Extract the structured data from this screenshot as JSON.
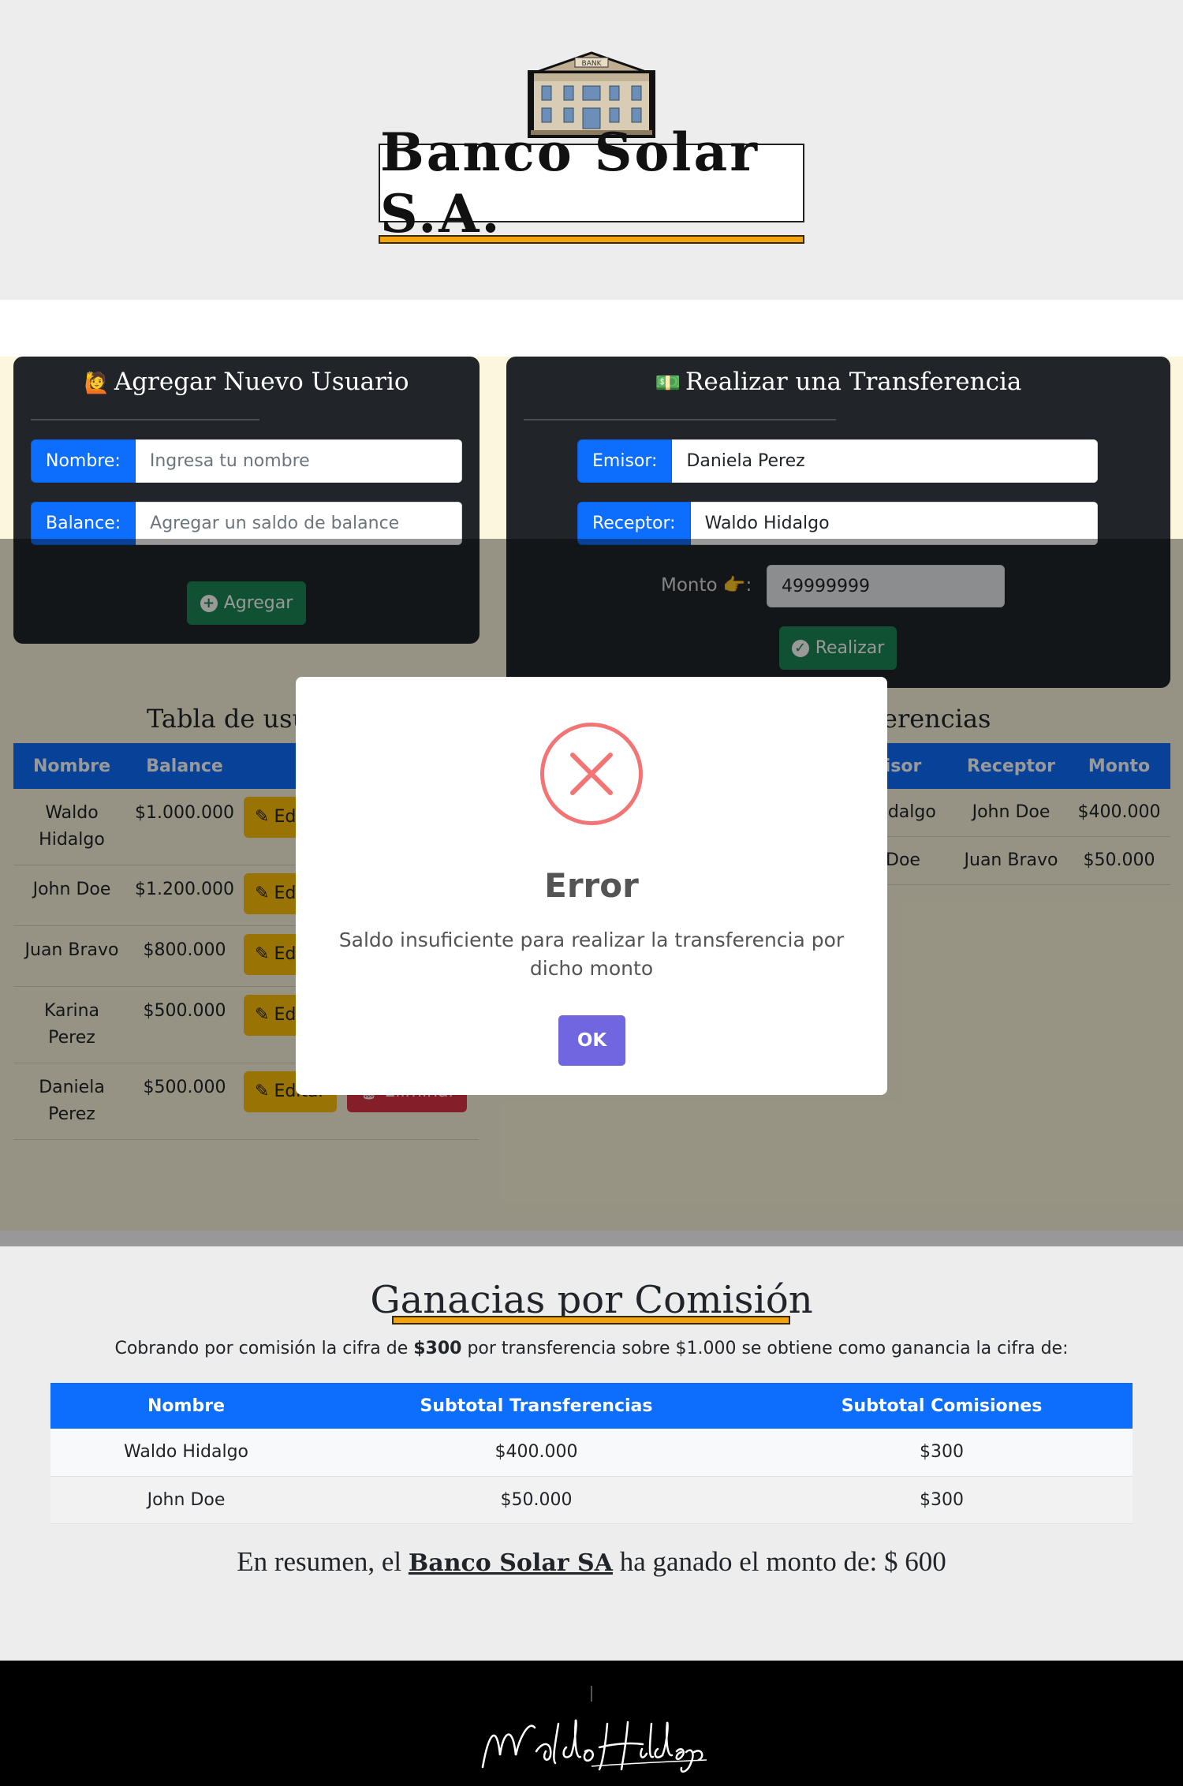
{
  "header": {
    "bank_sign": "BANK",
    "brand_title": "Banco Solar S.A."
  },
  "user_card": {
    "emoji": "🙋",
    "title": "Agregar Nuevo Usuario",
    "name_label": "Nombre:",
    "name_placeholder": "Ingresa tu nombre",
    "balance_label": "Balance:",
    "balance_placeholder": "Agregar un saldo de balance",
    "add_button": "Agregar",
    "add_icon": "plus-circle-icon"
  },
  "transfer_card": {
    "emoji": "💵",
    "title": "Realizar una Transferencia",
    "emisor_label": "Emisor:",
    "emisor_value": "Daniela Perez",
    "receptor_label": "Receptor:",
    "receptor_value": "Waldo Hidalgo",
    "monto_label": "Monto 👉:",
    "monto_value": "49999999",
    "submit_button": "Realizar",
    "submit_icon": "check-circle-icon"
  },
  "users_table": {
    "title": "Tabla de usua",
    "headers": [
      "Nombre",
      "Balance"
    ],
    "edit_label": "Editar",
    "delete_label": "Eliminar",
    "rows": [
      {
        "name": "Waldo Hidalgo",
        "balance": "$1.000.000"
      },
      {
        "name": "John Doe",
        "balance": "$1.200.000"
      },
      {
        "name": "Juan Bravo",
        "balance": "$800.000"
      },
      {
        "name": "Karina Perez",
        "balance": "$500.000"
      },
      {
        "name": "Daniela Perez",
        "balance": "$500.000"
      }
    ]
  },
  "transfers_table": {
    "title": "erencias",
    "headers": [
      "isor",
      "Receptor",
      "Monto"
    ],
    "rows": [
      {
        "emisor": "Hidalgo",
        "receptor": "John Doe",
        "monto": "$400.000"
      },
      {
        "emisor": "Doe",
        "receptor": "Juan Bravo",
        "monto": "$50.000"
      }
    ]
  },
  "modal": {
    "icon": "error-x-icon",
    "title": "Error",
    "text": "Saldo insuficiente para realizar la transferencia por dicho monto",
    "ok_button": "OK"
  },
  "ganancias": {
    "title": "Ganacias por Comisión",
    "desc_before": "Cobrando por comisión la cifra de",
    "desc_bold": "$300",
    "desc_after": "por transferencia sobre $1.000 se obtiene como ganancia la cifra de:",
    "headers": [
      "Nombre",
      "Subtotal Transferencias",
      "Subtotal Comisiones"
    ],
    "rows": [
      {
        "name": "Waldo Hidalgo",
        "subtotal": "$400.000",
        "comision": "$300"
      },
      {
        "name": "John Doe",
        "subtotal": "$50.000",
        "comision": "$300"
      }
    ],
    "summary_before": "En resumen, el",
    "summary_brand": "Banco Solar SA",
    "summary_after": "ha ganado el monto de: $ 600"
  },
  "footer": {
    "signature": "Waldo Hidalgo"
  },
  "colors": {
    "primary": "#0d6efd",
    "success": "#198754",
    "warning": "#ffc107",
    "danger": "#dc3545",
    "accent_gold": "#f2a30e",
    "modal_ok": "#7066e0",
    "error_red": "#f27474"
  }
}
